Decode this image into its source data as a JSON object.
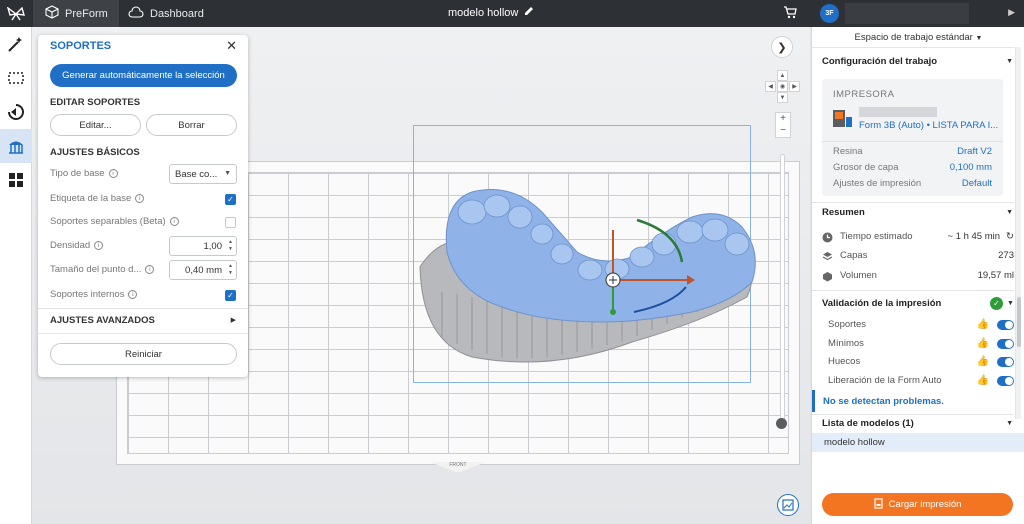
{
  "topbar": {
    "app_tab": "PreForm",
    "dashboard_tab": "Dashboard",
    "document_title": "modelo hollow",
    "account_initials": "3F",
    "icons": [
      "butterfly-logo-icon",
      "cube-icon",
      "cloud-icon",
      "pencil-icon",
      "cart-icon",
      "chevron-right-icon"
    ]
  },
  "toolrail": {
    "icons": [
      "magic-wand-icon",
      "select-box-icon",
      "orient-icon",
      "supports-icon",
      "layout-icon"
    ]
  },
  "supports_panel": {
    "title": "SOPORTES",
    "auto_generate": "Generar automáticamente la selección",
    "edit_section": "EDITAR SOPORTES",
    "edit_button": "Editar...",
    "delete_button": "Borrar",
    "basic_section": "AJUSTES BÁSICOS",
    "base_type_label": "Tipo de base",
    "base_type_value": "Base co...",
    "base_label_label": "Etiqueta de la base",
    "base_label_checked": true,
    "separable_label": "Soportes separables (Beta)",
    "separable_checked": false,
    "density_label": "Densidad",
    "density_value": "1,00",
    "point_size_label": "Tamaño del punto d...",
    "point_size_value": "0,40 mm",
    "internal_label": "Soportes internos",
    "internal_checked": true,
    "advanced_section": "AJUSTES AVANZADOS",
    "reset_button": "Reiniciar"
  },
  "viewport": {
    "front_label": "FRONT"
  },
  "sidebar": {
    "workspace": "Espacio de trabajo estándar",
    "job_config": "Configuración del trabajo",
    "printer_heading": "IMPRESORA",
    "printer_status": "Form 3B (Auto) • LISTA PARA I...",
    "resin_label": "Resina",
    "resin_value": "Draft V2",
    "layer_label": "Grosor de capa",
    "layer_value": "0,100 mm",
    "print_settings_label": "Ajustes de impresión",
    "print_settings_value": "Default",
    "summary": "Resumen",
    "time_label": "Tiempo estimado",
    "time_value": "~ 1 h 45 min",
    "layers_label": "Capas",
    "layers_value": "273",
    "volume_label": "Volumen",
    "volume_value": "19,57 ml",
    "validation": "Validación de la impresión",
    "validation_items": [
      {
        "label": "Soportes",
        "enabled": true
      },
      {
        "label": "Mínimos",
        "enabled": true
      },
      {
        "label": "Huecos",
        "enabled": true
      },
      {
        "label": "Liberación de la Form Auto",
        "enabled": true
      }
    ],
    "no_problems": "No se detectan problemas.",
    "model_list": "Lista de modelos (1)",
    "model_name": "modelo hollow",
    "print_button": "Cargar impresión"
  },
  "colors": {
    "accent": "#1f6fc7",
    "topbar": "#2d3034",
    "print_button": "#f47521",
    "ok_green": "#2e9b3a"
  }
}
